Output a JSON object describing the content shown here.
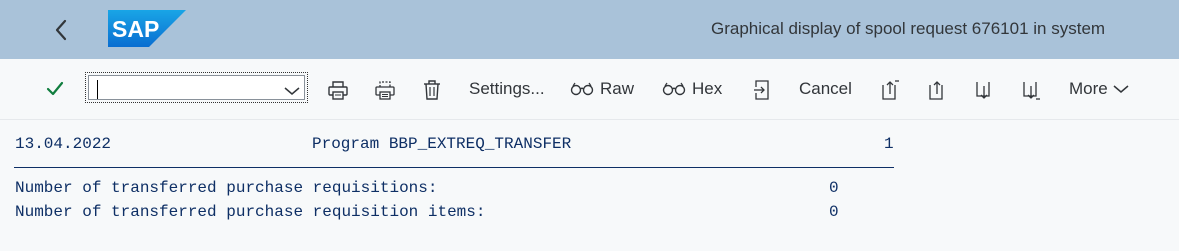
{
  "header": {
    "title": "Graphical display of spool request 676101 in system",
    "logo_text": "SAP",
    "brand_color": "#0a6ed1",
    "bar_color": "#a9c2d9"
  },
  "toolbar": {
    "command_field": {
      "value": "",
      "placeholder": ""
    },
    "settings_label": "Settings...",
    "raw_label": "Raw",
    "hex_label": "Hex",
    "cancel_label": "Cancel",
    "more_label": "More",
    "icons": [
      "check-icon",
      "print-icon",
      "print-preview-icon",
      "delete-icon",
      "glasses-icon",
      "export-icon",
      "first-page-icon",
      "previous-page-icon",
      "next-page-icon",
      "last-page-icon",
      "chevron-down-icon"
    ],
    "accent_color": "#107e3e"
  },
  "spool": {
    "date": "13.04.2022",
    "program": "Program BBP_EXTREQ_TRANSFER",
    "page_number": "1",
    "lines": [
      {
        "label": "Number of transferred purchase requisitions:",
        "value": "0"
      },
      {
        "label": "Number of transferred purchase requisition items:",
        "value": "0"
      }
    ]
  }
}
